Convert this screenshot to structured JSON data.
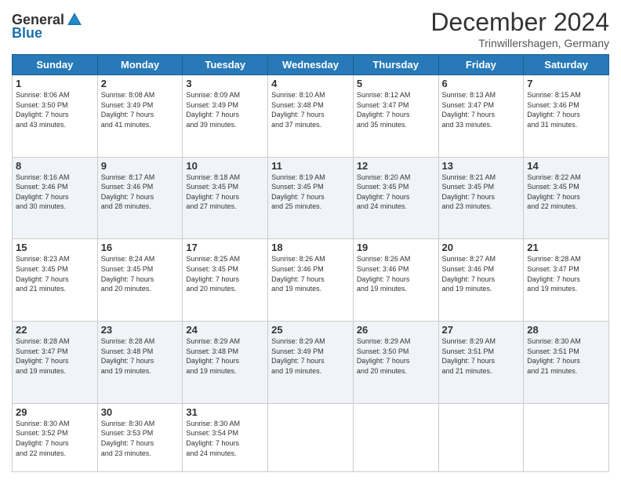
{
  "header": {
    "logo_general": "General",
    "logo_blue": "Blue",
    "month_title": "December 2024",
    "subtitle": "Trinwillershagen, Germany"
  },
  "days_of_week": [
    "Sunday",
    "Monday",
    "Tuesday",
    "Wednesday",
    "Thursday",
    "Friday",
    "Saturday"
  ],
  "weeks": [
    [
      {
        "day": "1",
        "info": "Sunrise: 8:06 AM\nSunset: 3:50 PM\nDaylight: 7 hours\nand 43 minutes."
      },
      {
        "day": "2",
        "info": "Sunrise: 8:08 AM\nSunset: 3:49 PM\nDaylight: 7 hours\nand 41 minutes."
      },
      {
        "day": "3",
        "info": "Sunrise: 8:09 AM\nSunset: 3:49 PM\nDaylight: 7 hours\nand 39 minutes."
      },
      {
        "day": "4",
        "info": "Sunrise: 8:10 AM\nSunset: 3:48 PM\nDaylight: 7 hours\nand 37 minutes."
      },
      {
        "day": "5",
        "info": "Sunrise: 8:12 AM\nSunset: 3:47 PM\nDaylight: 7 hours\nand 35 minutes."
      },
      {
        "day": "6",
        "info": "Sunrise: 8:13 AM\nSunset: 3:47 PM\nDaylight: 7 hours\nand 33 minutes."
      },
      {
        "day": "7",
        "info": "Sunrise: 8:15 AM\nSunset: 3:46 PM\nDaylight: 7 hours\nand 31 minutes."
      }
    ],
    [
      {
        "day": "8",
        "info": "Sunrise: 8:16 AM\nSunset: 3:46 PM\nDaylight: 7 hours\nand 30 minutes."
      },
      {
        "day": "9",
        "info": "Sunrise: 8:17 AM\nSunset: 3:46 PM\nDaylight: 7 hours\nand 28 minutes."
      },
      {
        "day": "10",
        "info": "Sunrise: 8:18 AM\nSunset: 3:45 PM\nDaylight: 7 hours\nand 27 minutes."
      },
      {
        "day": "11",
        "info": "Sunrise: 8:19 AM\nSunset: 3:45 PM\nDaylight: 7 hours\nand 25 minutes."
      },
      {
        "day": "12",
        "info": "Sunrise: 8:20 AM\nSunset: 3:45 PM\nDaylight: 7 hours\nand 24 minutes."
      },
      {
        "day": "13",
        "info": "Sunrise: 8:21 AM\nSunset: 3:45 PM\nDaylight: 7 hours\nand 23 minutes."
      },
      {
        "day": "14",
        "info": "Sunrise: 8:22 AM\nSunset: 3:45 PM\nDaylight: 7 hours\nand 22 minutes."
      }
    ],
    [
      {
        "day": "15",
        "info": "Sunrise: 8:23 AM\nSunset: 3:45 PM\nDaylight: 7 hours\nand 21 minutes."
      },
      {
        "day": "16",
        "info": "Sunrise: 8:24 AM\nSunset: 3:45 PM\nDaylight: 7 hours\nand 20 minutes."
      },
      {
        "day": "17",
        "info": "Sunrise: 8:25 AM\nSunset: 3:45 PM\nDaylight: 7 hours\nand 20 minutes."
      },
      {
        "day": "18",
        "info": "Sunrise: 8:26 AM\nSunset: 3:46 PM\nDaylight: 7 hours\nand 19 minutes."
      },
      {
        "day": "19",
        "info": "Sunrise: 8:26 AM\nSunset: 3:46 PM\nDaylight: 7 hours\nand 19 minutes."
      },
      {
        "day": "20",
        "info": "Sunrise: 8:27 AM\nSunset: 3:46 PM\nDaylight: 7 hours\nand 19 minutes."
      },
      {
        "day": "21",
        "info": "Sunrise: 8:28 AM\nSunset: 3:47 PM\nDaylight: 7 hours\nand 19 minutes."
      }
    ],
    [
      {
        "day": "22",
        "info": "Sunrise: 8:28 AM\nSunset: 3:47 PM\nDaylight: 7 hours\nand 19 minutes."
      },
      {
        "day": "23",
        "info": "Sunrise: 8:28 AM\nSunset: 3:48 PM\nDaylight: 7 hours\nand 19 minutes."
      },
      {
        "day": "24",
        "info": "Sunrise: 8:29 AM\nSunset: 3:48 PM\nDaylight: 7 hours\nand 19 minutes."
      },
      {
        "day": "25",
        "info": "Sunrise: 8:29 AM\nSunset: 3:49 PM\nDaylight: 7 hours\nand 19 minutes."
      },
      {
        "day": "26",
        "info": "Sunrise: 8:29 AM\nSunset: 3:50 PM\nDaylight: 7 hours\nand 20 minutes."
      },
      {
        "day": "27",
        "info": "Sunrise: 8:29 AM\nSunset: 3:51 PM\nDaylight: 7 hours\nand 21 minutes."
      },
      {
        "day": "28",
        "info": "Sunrise: 8:30 AM\nSunset: 3:51 PM\nDaylight: 7 hours\nand 21 minutes."
      }
    ],
    [
      {
        "day": "29",
        "info": "Sunrise: 8:30 AM\nSunset: 3:52 PM\nDaylight: 7 hours\nand 22 minutes."
      },
      {
        "day": "30",
        "info": "Sunrise: 8:30 AM\nSunset: 3:53 PM\nDaylight: 7 hours\nand 23 minutes."
      },
      {
        "day": "31",
        "info": "Sunrise: 8:30 AM\nSunset: 3:54 PM\nDaylight: 7 hours\nand 24 minutes."
      },
      {
        "day": "",
        "info": ""
      },
      {
        "day": "",
        "info": ""
      },
      {
        "day": "",
        "info": ""
      },
      {
        "day": "",
        "info": ""
      }
    ]
  ]
}
